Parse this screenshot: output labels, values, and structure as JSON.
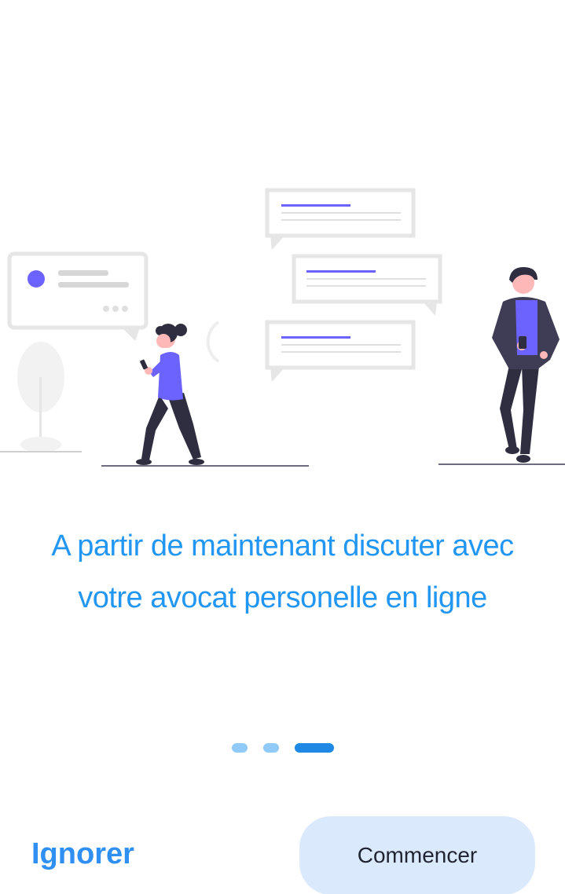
{
  "onboarding": {
    "headline_line1": "A partir de maintenant discuter avec",
    "headline_line2": "votre avocat personelle en ligne",
    "page_indicator": {
      "total": 3,
      "current": 3
    },
    "skip_label": "Ignorer",
    "start_label": "Commencer"
  },
  "colors": {
    "accent": "#2196f3",
    "illustration_purple": "#6c63ff",
    "button_bg": "#dbe9fd",
    "dot_inactive": "#90caf9",
    "dot_active": "#1e88e5"
  },
  "illustration": {
    "icon": "chat-illustration"
  }
}
